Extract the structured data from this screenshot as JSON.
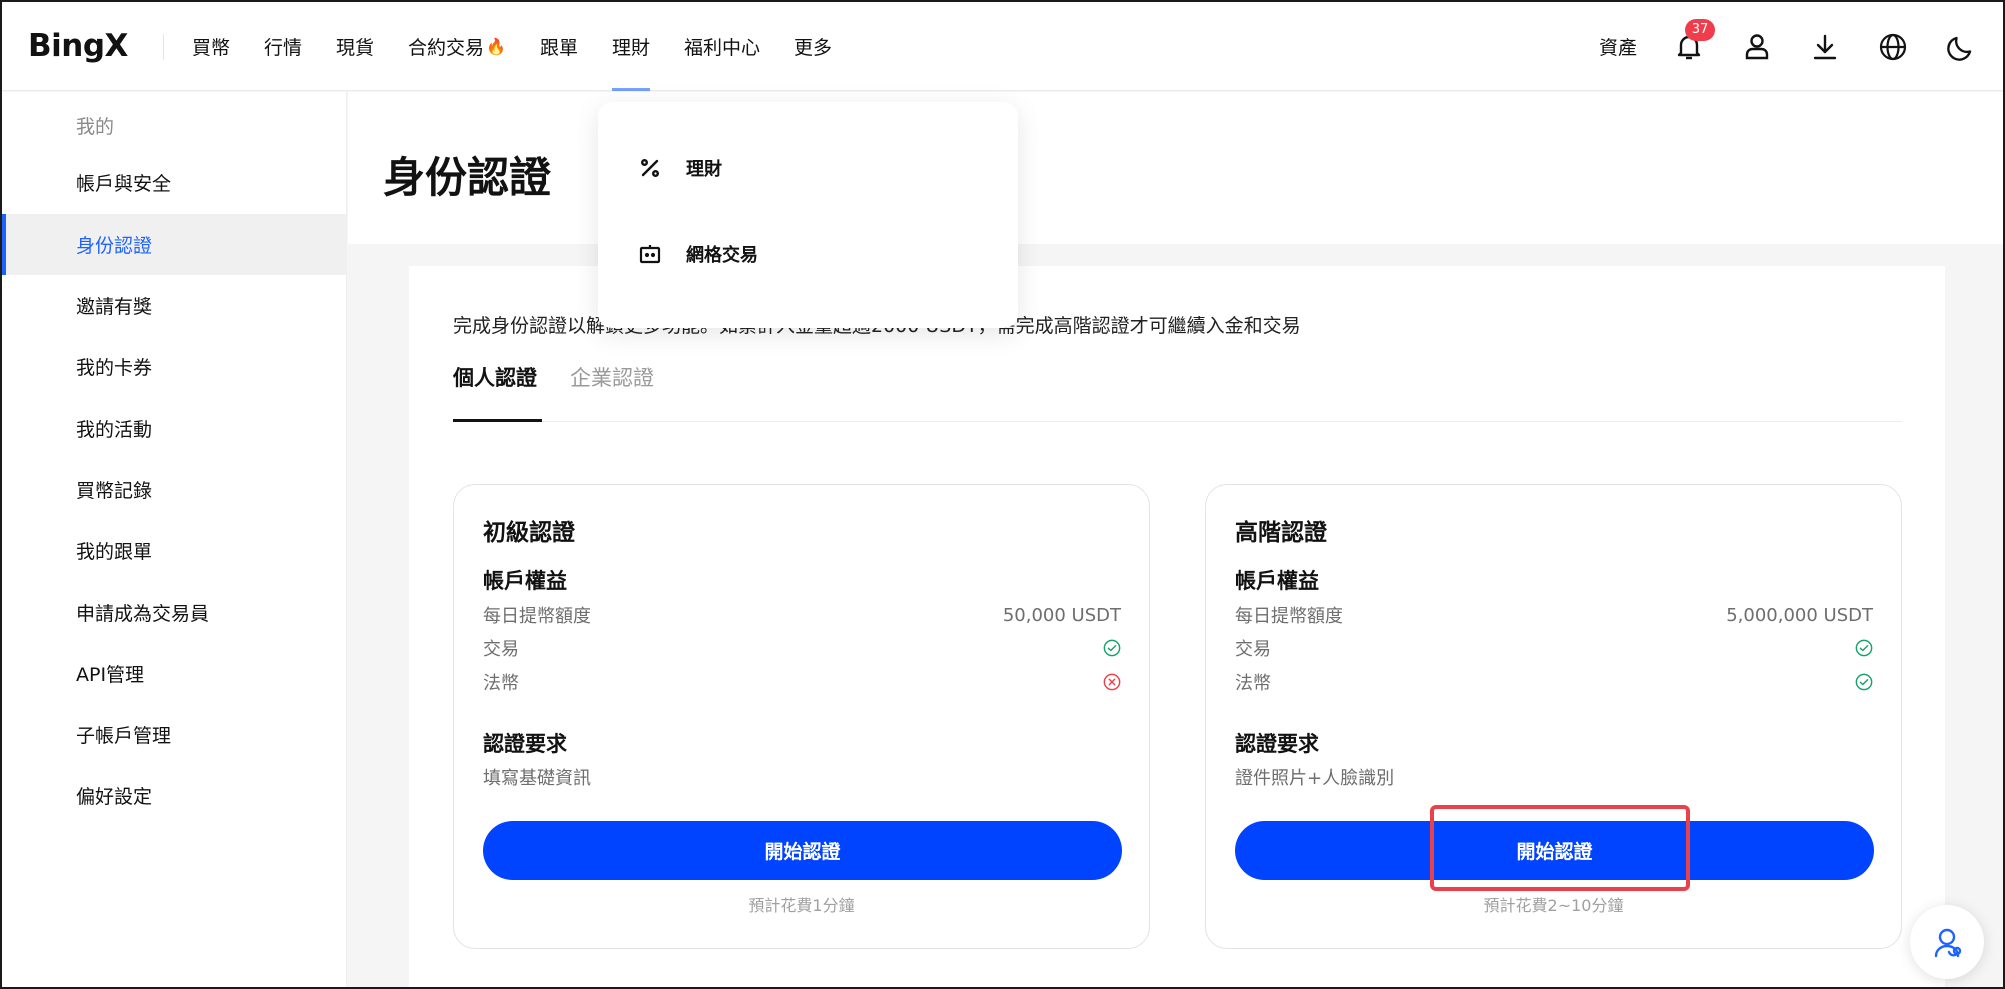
{
  "header": {
    "logo": "BingX",
    "nav": [
      "買幣",
      "行情",
      "現貨",
      "合約交易",
      "跟單",
      "理財",
      "福利中心",
      "更多"
    ],
    "assets": "資產",
    "notification_count": "37",
    "accent": "#1f63ff"
  },
  "dropdown": {
    "items": [
      {
        "label": "理財",
        "icon": "percent-icon"
      },
      {
        "label": "網格交易",
        "icon": "grid-bot-icon"
      }
    ]
  },
  "sidebar": {
    "heading": "我的",
    "items": [
      "帳戶與安全",
      "身份認證",
      "邀請有獎",
      "我的卡券",
      "我的活動",
      "買幣記錄",
      "我的跟單",
      "申請成為交易員",
      "API管理",
      "子帳戶管理",
      "偏好設定"
    ],
    "active_index": 1
  },
  "page": {
    "title": "身份認證",
    "notice": "完成身份認證以解鎖更多功能。如累計入金量超過2000 USDT，需完成高階認證才可繼續入金和交易",
    "tabs": [
      "個人認證",
      "企業認證"
    ]
  },
  "cards": [
    {
      "title": "初級認證",
      "rights_label": "帳戶權益",
      "rows": [
        {
          "label": "每日提幣額度",
          "value": "50,000 USDT"
        },
        {
          "label": "交易",
          "status": "ok"
        },
        {
          "label": "法幣",
          "status": "no"
        }
      ],
      "req_label": "認證要求",
      "req_text": "填寫基礎資訊",
      "button": "開始認證",
      "time": "預計花費1分鐘"
    },
    {
      "title": "高階認證",
      "rights_label": "帳戶權益",
      "rows": [
        {
          "label": "每日提幣額度",
          "value": "5,000,000 USDT"
        },
        {
          "label": "交易",
          "status": "ok"
        },
        {
          "label": "法幣",
          "status": "ok"
        }
      ],
      "req_label": "認證要求",
      "req_text": "證件照片+人臉識別",
      "button": "開始認證",
      "time": "預計花費2~10分鐘"
    }
  ],
  "colors": {
    "primary_button": "#0044ff",
    "success": "#1aa06d",
    "error": "#e8414c"
  }
}
